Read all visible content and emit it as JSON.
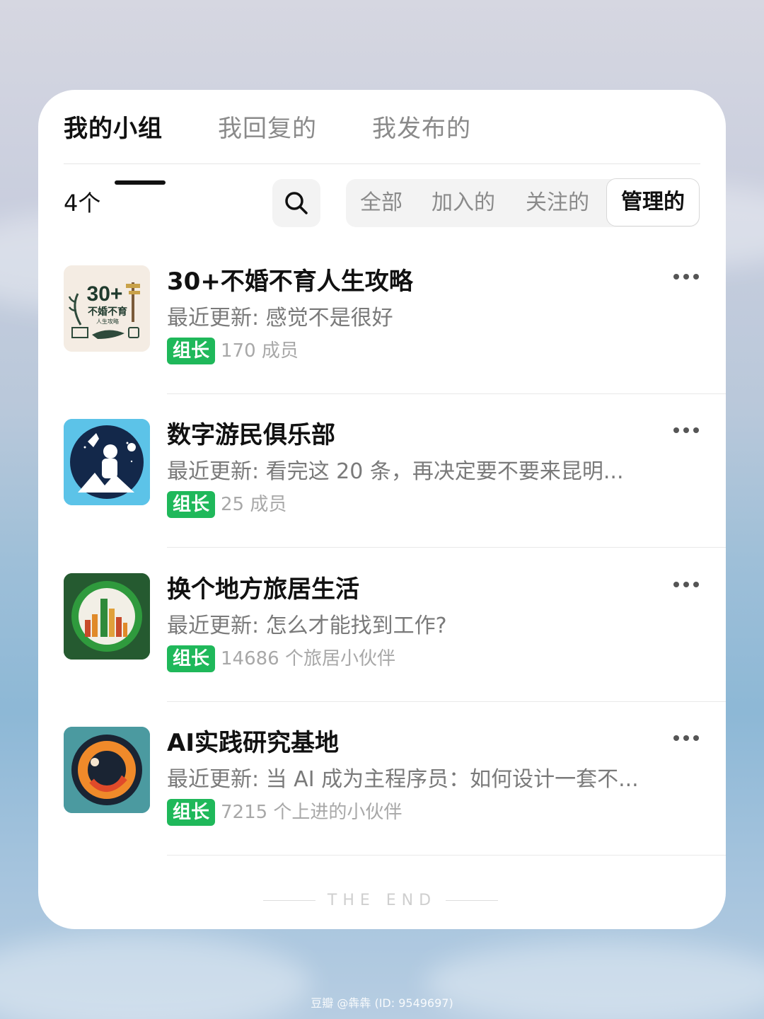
{
  "tabs": [
    {
      "label": "我的小组",
      "active": true
    },
    {
      "label": "我回复的",
      "active": false
    },
    {
      "label": "我发布的",
      "active": false
    }
  ],
  "count_label": "4个",
  "search_icon": "search-icon",
  "filters": [
    {
      "label": "全部",
      "active": false
    },
    {
      "label": "加入的",
      "active": false
    },
    {
      "label": "关注的",
      "active": false
    },
    {
      "label": "管理的",
      "active": true
    }
  ],
  "groups": [
    {
      "title": "30+不婚不育人生攻略",
      "update": "最近更新: 感觉不是很好",
      "role": "组长",
      "members": "170 成员",
      "avatar_icon": "30plus-logo",
      "avatar_text": [
        "30+",
        "不婚不育",
        "人生攻略"
      ]
    },
    {
      "title": "数字游民俱乐部",
      "update": "最近更新: 看完这 20 条，再决定要不要来昆明...",
      "role": "组长",
      "members": "25 成员",
      "avatar_icon": "astronaut-logo"
    },
    {
      "title": "换个地方旅居生活",
      "update": "最近更新: 怎么才能找到工作?",
      "role": "组长",
      "members": "14686 个旅居小伙伴",
      "avatar_icon": "city-logo"
    },
    {
      "title": "AI实践研究基地",
      "update": "最近更新: 当 AI 成为主程序员：如何设计一套不...",
      "role": "组长",
      "members": "7215 个上进的小伙伴",
      "avatar_icon": "ring-logo"
    }
  ],
  "end_label": "THE END",
  "watermark": "豆瓣  @犇犇 (ID: 9549697)",
  "colors": {
    "badge_green": "#1fb85a",
    "text_primary": "#111111",
    "text_secondary": "#7a7a7a"
  }
}
